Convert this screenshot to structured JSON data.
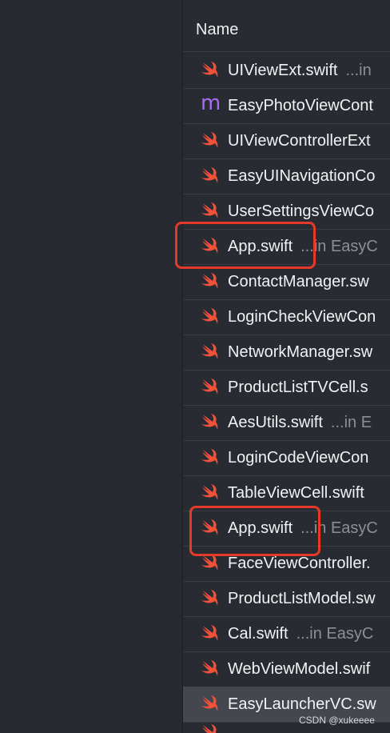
{
  "header": {
    "name_label": "Name"
  },
  "files": [
    {
      "icon": "swift-icon",
      "name": "UIViewExt.swift",
      "path": "...in"
    },
    {
      "icon": "objc-m-icon",
      "name": "EasyPhotoViewCont",
      "path": ""
    },
    {
      "icon": "swift-icon",
      "name": "UIViewControllerExt",
      "path": ""
    },
    {
      "icon": "swift-icon",
      "name": "EasyUINavigationCo",
      "path": ""
    },
    {
      "icon": "swift-icon",
      "name": "UserSettingsViewCo",
      "path": ""
    },
    {
      "icon": "swift-icon",
      "name": "App.swift",
      "path": "...in EasyC"
    },
    {
      "icon": "swift-icon",
      "name": "ContactManager.sw",
      "path": ""
    },
    {
      "icon": "swift-icon",
      "name": "LoginCheckViewCon",
      "path": ""
    },
    {
      "icon": "swift-icon",
      "name": "NetworkManager.sw",
      "path": ""
    },
    {
      "icon": "swift-icon",
      "name": "ProductListTVCell.s",
      "path": ""
    },
    {
      "icon": "swift-icon",
      "name": "AesUtils.swift",
      "path": "...in E"
    },
    {
      "icon": "swift-icon",
      "name": "LoginCodeViewCon",
      "path": ""
    },
    {
      "icon": "swift-icon",
      "name": "TableViewCell.swift",
      "path": ""
    },
    {
      "icon": "swift-icon",
      "name": "App.swift",
      "path": "...in EasyC"
    },
    {
      "icon": "swift-icon",
      "name": "FaceViewController.",
      "path": ""
    },
    {
      "icon": "swift-icon",
      "name": "ProductListModel.sw",
      "path": ""
    },
    {
      "icon": "swift-icon",
      "name": "Cal.swift",
      "path": "...in EasyC"
    },
    {
      "icon": "swift-icon",
      "name": "WebViewModel.swif",
      "path": ""
    },
    {
      "icon": "swift-icon",
      "name": "EasyLauncherVC.sw",
      "path": ""
    }
  ],
  "selected_index": 18,
  "highlighted_indices": [
    5,
    13
  ],
  "watermark": "CSDN @xukeeee",
  "colors": {
    "swift_orange": "#f05138",
    "objc_purple": "#a66ef5",
    "highlight_red": "#e53a2a"
  }
}
